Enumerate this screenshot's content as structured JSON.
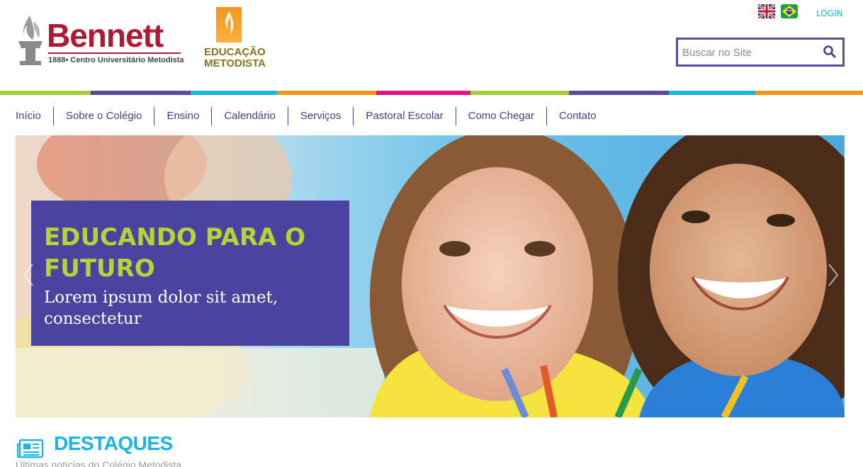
{
  "header": {
    "logo_bennett": {
      "name": "Bennett",
      "subtitle": "1888• Centro Universitário Metodista",
      "brand_color": "#b0192f"
    },
    "logo_educacao": {
      "line1": "EDUCAÇÃO",
      "line2": "METODISTA"
    },
    "flags": [
      {
        "name": "uk-flag-icon"
      },
      {
        "name": "brazil-flag-icon"
      }
    ],
    "login_label": "LOGIN",
    "search": {
      "placeholder": "Buscar no Site",
      "value": ""
    }
  },
  "color_strip": [
    "#a6ce39",
    "#5b4a9e",
    "#1ab4e6",
    "#f7941d",
    "#e3157f",
    "#a6ce39",
    "#5b4a9e",
    "#1ab4e6",
    "#f7941d"
  ],
  "nav": {
    "items": [
      {
        "label": "Início"
      },
      {
        "label": "Sobre o Colégio"
      },
      {
        "label": "Ensino"
      },
      {
        "label": "Calendário"
      },
      {
        "label": "Serviços"
      },
      {
        "label": "Pastoral Escolar"
      },
      {
        "label": "Como Chegar"
      },
      {
        "label": "Contato"
      }
    ]
  },
  "hero": {
    "title": "EDUCANDO PARA O FUTURO",
    "subtitle": "Lorem ipsum dolor sit amet, consectetur",
    "caption_color": "#4a43a0",
    "title_color": "#b4d335"
  },
  "destaques": {
    "title": "DESTAQUES",
    "subtitle": "Últimas notícias do Colégio Metodista"
  }
}
